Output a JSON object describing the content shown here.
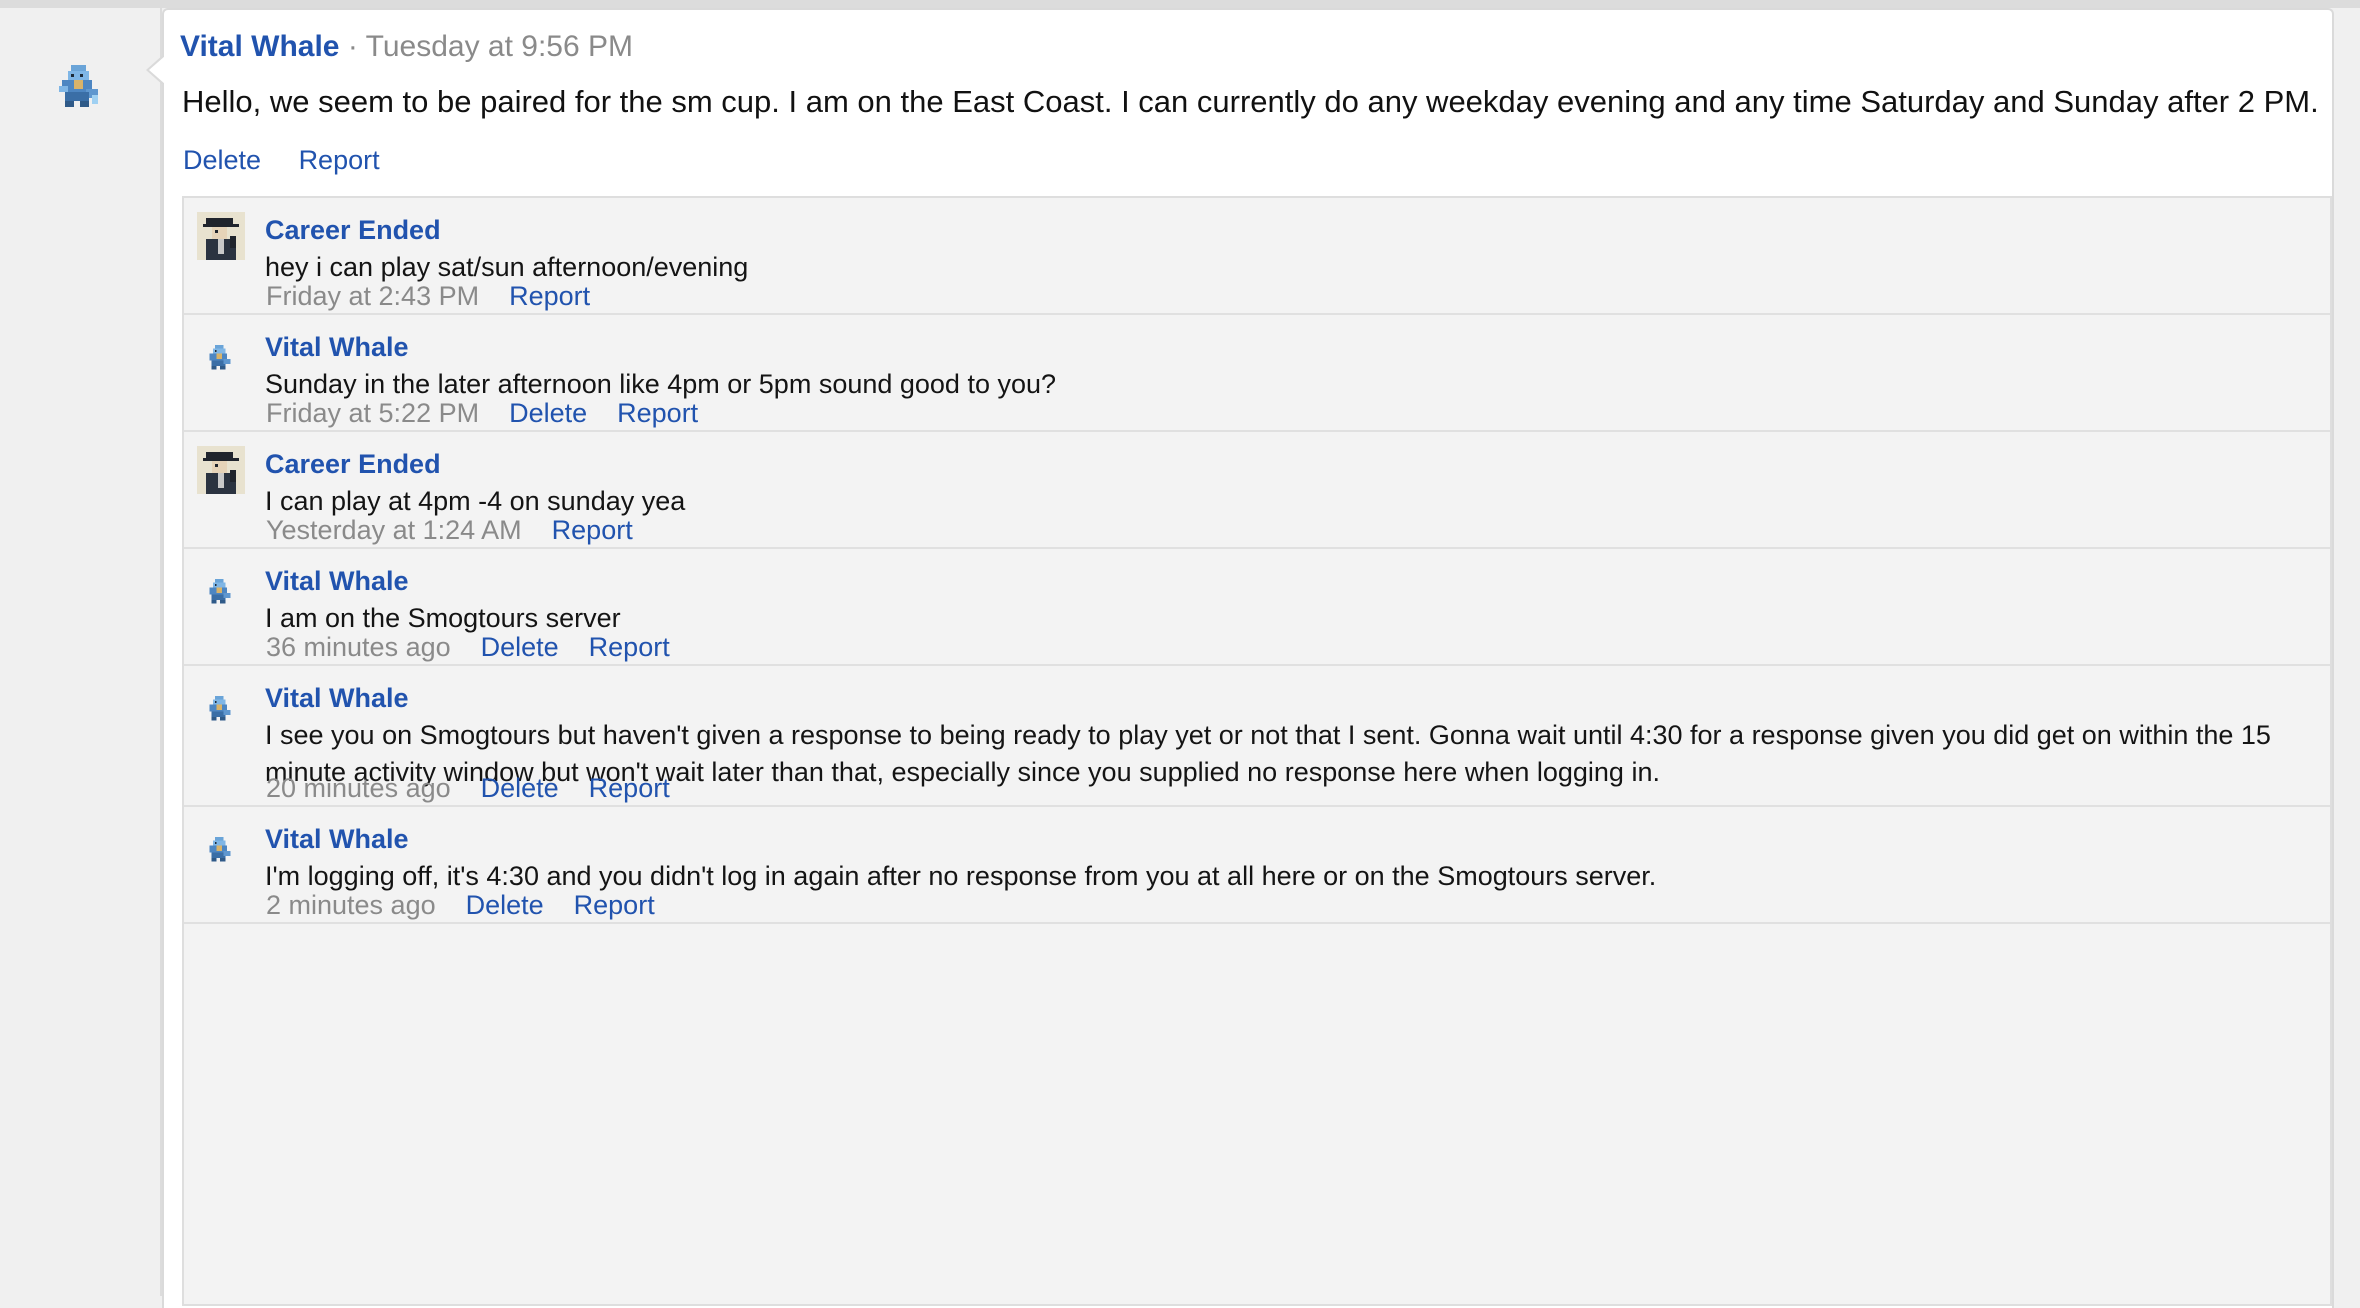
{
  "post": {
    "author": "Vital Whale",
    "separator": "·",
    "date": "Tuesday at 9:56 PM",
    "body": "Hello, we seem to be paired for the sm cup. I am on the East Coast. I can currently do any weekday evening and any time Saturday and Sunday after 2 PM.",
    "actions": {
      "delete": "Delete",
      "report": "Report"
    }
  },
  "comments": [
    {
      "author": "Career Ended",
      "avatar": "character-avatar",
      "text": "hey i can play sat/sun afternoon/evening",
      "time": "Friday at 2:43 PM",
      "delete": "",
      "report": "Report"
    },
    {
      "author": "Vital Whale",
      "avatar": "sprite-avatar",
      "text": "Sunday in the later afternoon like 4pm or 5pm sound good to you?",
      "time": "Friday at 5:22 PM",
      "delete": "Delete",
      "report": "Report"
    },
    {
      "author": "Career Ended",
      "avatar": "character-avatar",
      "text": "I can play at 4pm -4 on sunday yea",
      "time": "Yesterday at 1:24 AM",
      "delete": "",
      "report": "Report"
    },
    {
      "author": "Vital Whale",
      "avatar": "sprite-avatar",
      "text": "I am on the Smogtours server",
      "time": "36 minutes ago",
      "delete": "Delete",
      "report": "Report"
    },
    {
      "author": "Vital Whale",
      "avatar": "sprite-avatar",
      "text": "I see you on Smogtours but haven't given a response to being ready to play yet or not that I sent. Gonna wait until 4:30 for a response given you did get on within the 15 minute activity window but won't wait later than that, especially since you supplied no response here when logging in.",
      "time": "20 minutes ago",
      "delete": "Delete",
      "report": "Report"
    },
    {
      "author": "Vital Whale",
      "avatar": "sprite-avatar",
      "text": "I'm logging off, it's 4:30 and you didn't log in again after no response from you at all here or on the Smogtours server.",
      "time": "2 minutes ago",
      "delete": "Delete",
      "report": "Report"
    }
  ],
  "colors": {
    "link": "#2153ae",
    "muted": "#8a8a8a",
    "comment_bg": "#f3f3f3"
  }
}
